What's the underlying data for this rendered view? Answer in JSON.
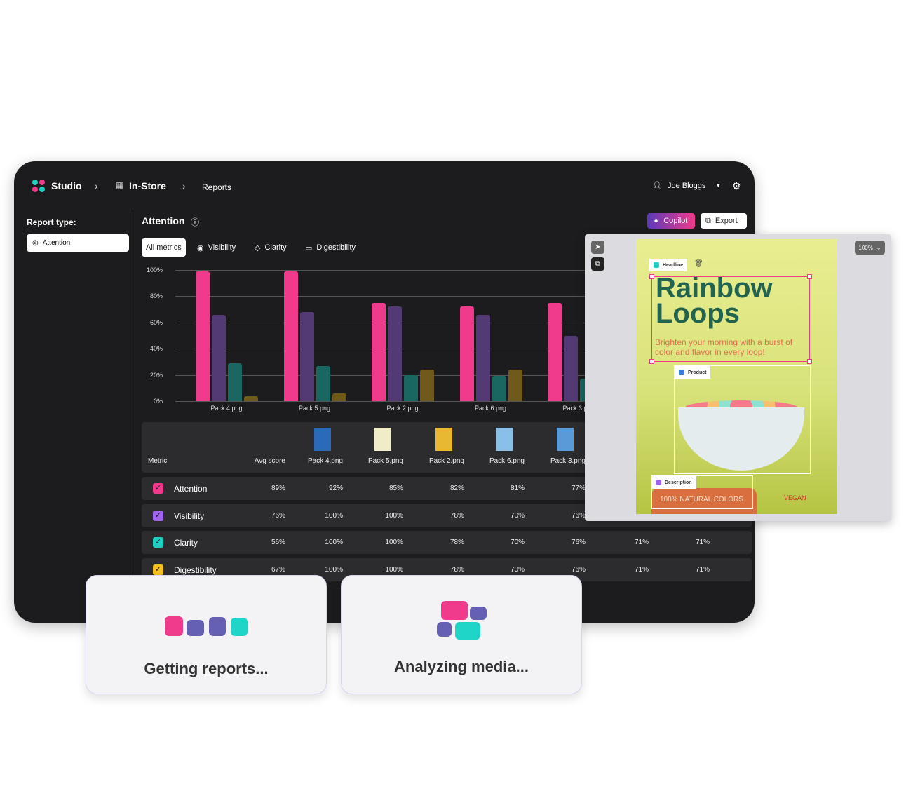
{
  "breadcrumb": {
    "app": "Studio",
    "section": "In-Store",
    "page": "Reports"
  },
  "user": {
    "name": "Joe Bloggs"
  },
  "sidebar": {
    "label": "Report type:",
    "selected": "Attention"
  },
  "main": {
    "title": "Attention",
    "copilot": "Copilot",
    "export": "Export",
    "tabs": [
      "All metrics",
      "Visibility",
      "Clarity",
      "Digestibility"
    ]
  },
  "colors": {
    "attention": "#f03a8c",
    "visibility": "#543a75",
    "clarity": "#196760",
    "digestibility": "#6f5a1b"
  },
  "chart_data": {
    "type": "bar",
    "categories": [
      "Pack 4.png",
      "Pack 5.png",
      "Pack 2.png",
      "Pack 6.png",
      "Pack 3.png"
    ],
    "yticks": [
      "0%",
      "20%",
      "40%",
      "60%",
      "80%",
      "100%"
    ],
    "ylim": [
      0,
      100
    ],
    "grid": true,
    "series": [
      {
        "values": [
          99,
          99,
          75,
          72,
          75
        ]
      },
      {
        "values": [
          66,
          68,
          72,
          66,
          50
        ]
      },
      {
        "values": [
          29,
          27,
          20,
          19,
          17
        ]
      },
      {
        "values": [
          4,
          6,
          24,
          24,
          null
        ]
      }
    ]
  },
  "table": {
    "headers": {
      "metric": "Metric",
      "avg": "Avg score",
      "packs": [
        "Pack 4.png",
        "Pack 5.png",
        "Pack 2.png",
        "Pack 6.png",
        "Pack 3.png"
      ]
    },
    "rows": [
      {
        "name": "Attention",
        "color": "#f03a8c",
        "avg": "89%",
        "values": [
          "92%",
          "85%",
          "82%",
          "81%",
          "77%"
        ]
      },
      {
        "name": "Visibility",
        "color": "#a064f0",
        "avg": "76%",
        "values": [
          "100%",
          "100%",
          "78%",
          "70%",
          "76%"
        ]
      },
      {
        "name": "Clarity",
        "color": "#1fd0c0",
        "avg": "56%",
        "values": [
          "100%",
          "100%",
          "78%",
          "70%",
          "76%",
          "71%",
          "71%"
        ]
      },
      {
        "name": "Digestibility",
        "color": "#f5c022",
        "avg": "67%",
        "values": [
          "100%",
          "100%",
          "78%",
          "70%",
          "76%",
          "71%",
          "71%"
        ]
      }
    ]
  },
  "editor": {
    "zoom": "100%",
    "headline_tag": "Headline",
    "product_tag": "Product",
    "description_tag": "Description",
    "title1": "Rainbow",
    "title2": "Loops",
    "subtitle": "Brighten your morning with a burst of color and flavor in every loop!",
    "badge": "100% NATURAL COLORS",
    "vegan": "VEGAN"
  },
  "loading": {
    "reports": "Getting reports...",
    "media": "Analyzing media..."
  }
}
